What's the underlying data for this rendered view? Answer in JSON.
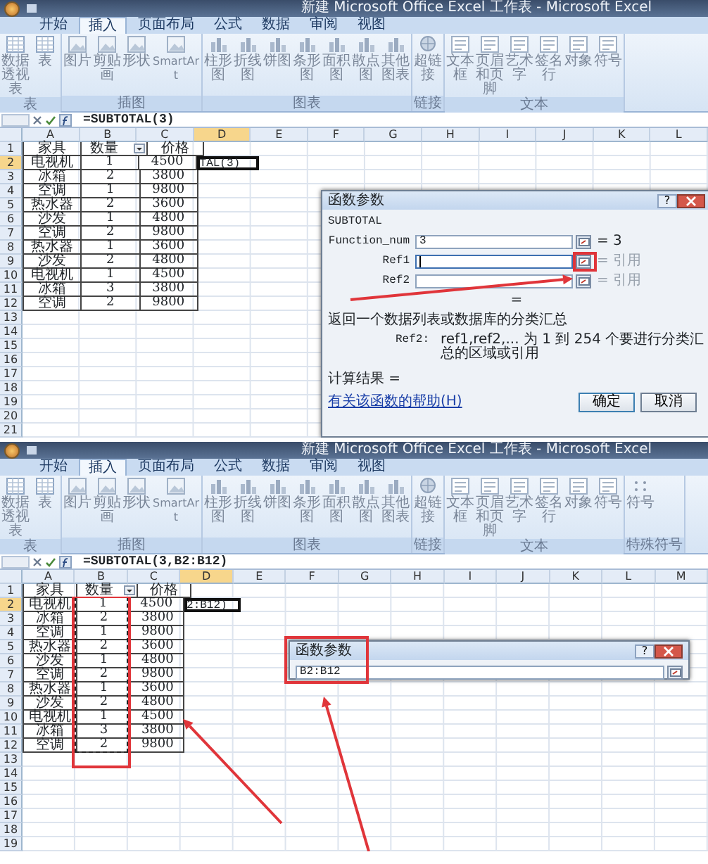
{
  "panels": [
    {
      "window_title": "新建 Microsoft Office Excel 工作表 - Microsoft Excel",
      "tabs": [
        {
          "label": "开始",
          "selected": false
        },
        {
          "label": "插入",
          "selected": true
        },
        {
          "label": "页面布局",
          "selected": false
        },
        {
          "label": "公式",
          "selected": false
        },
        {
          "label": "数据",
          "selected": false
        },
        {
          "label": "审阅",
          "selected": false
        },
        {
          "label": "视图",
          "selected": false
        }
      ],
      "ribbon_groups": [
        {
          "label": "表",
          "buttons": [
            "数据透视表",
            "表"
          ]
        },
        {
          "label": "插图",
          "buttons": [
            "图片",
            "剪贴画",
            "形状",
            "SmartArt"
          ]
        },
        {
          "label": "图表",
          "buttons": [
            "柱形图",
            "折线图",
            "饼图",
            "条形图",
            "面积图",
            "散点图",
            "其他图表"
          ]
        },
        {
          "label": "链接",
          "buttons": [
            "超链接"
          ]
        },
        {
          "label": "文本",
          "buttons": [
            "文本框",
            "页眉和页脚",
            "艺术字",
            "签名行",
            "对象",
            "符号"
          ]
        }
      ],
      "formula": "=SUBTOTAL(3)",
      "columns": [
        {
          "label": "A",
          "selected": false
        },
        {
          "label": "B",
          "selected": false
        },
        {
          "label": "C",
          "selected": false
        },
        {
          "label": "D",
          "selected": true
        },
        {
          "label": "E",
          "selected": false
        },
        {
          "label": "F",
          "selected": false
        },
        {
          "label": "G",
          "selected": false
        },
        {
          "label": "H",
          "selected": false
        },
        {
          "label": "I",
          "selected": false
        },
        {
          "label": "J",
          "selected": false
        },
        {
          "label": "K",
          "selected": false
        },
        {
          "label": "L",
          "selected": false
        }
      ],
      "rows": [
        {
          "number": "1",
          "selected": false,
          "cells": [
            "家具",
            "数量",
            "价格"
          ]
        },
        {
          "number": "2",
          "selected": true,
          "cells": [
            "电视机",
            "1",
            "4500",
            "TAL(3)"
          ]
        },
        {
          "number": "3",
          "selected": false,
          "cells": [
            "冰箱",
            "2",
            "3800"
          ]
        },
        {
          "number": "4",
          "selected": false,
          "cells": [
            "空调",
            "1",
            "9800"
          ]
        },
        {
          "number": "5",
          "selected": false,
          "cells": [
            "热水器",
            "2",
            "3600"
          ]
        },
        {
          "number": "6",
          "selected": false,
          "cells": [
            "沙发",
            "1",
            "4800"
          ]
        },
        {
          "number": "7",
          "selected": false,
          "cells": [
            "空调",
            "2",
            "9800"
          ]
        },
        {
          "number": "8",
          "selected": false,
          "cells": [
            "热水器",
            "1",
            "3600"
          ]
        },
        {
          "number": "9",
          "selected": false,
          "cells": [
            "沙发",
            "2",
            "4800"
          ]
        },
        {
          "number": "10",
          "selected": false,
          "cells": [
            "电视机",
            "1",
            "4500"
          ]
        },
        {
          "number": "11",
          "selected": false,
          "cells": [
            "冰箱",
            "3",
            "3800"
          ]
        },
        {
          "number": "12",
          "selected": false,
          "cells": [
            "空调",
            "2",
            "9800"
          ]
        },
        {
          "number": "13",
          "selected": false
        },
        {
          "number": "14",
          "selected": false
        },
        {
          "number": "15",
          "selected": false
        },
        {
          "number": "16",
          "selected": false
        },
        {
          "number": "17",
          "selected": false
        },
        {
          "number": "18",
          "selected": false
        },
        {
          "number": "19",
          "selected": false
        },
        {
          "number": "20",
          "selected": false
        },
        {
          "number": "21",
          "selected": false
        }
      ],
      "filter_button": true,
      "dialog": {
        "kind": "full",
        "title": "函数参数",
        "help": "?",
        "function_name": "SUBTOTAL",
        "args": [
          {
            "name": "Function_num",
            "value": "3",
            "focused": false,
            "result": "= 3"
          },
          {
            "name": "Ref1",
            "focused": true,
            "result": "= 引用"
          },
          {
            "name": "Ref2",
            "focused": false,
            "result": "= 引用"
          }
        ],
        "equals": "=",
        "description": "返回一个数据列表或数据库的分类汇总",
        "arg_help_name": "Ref2:",
        "arg_help": "ref1,ref2,... 为 1 到 254 个要进行分类汇总的区域或引用",
        "result_label": "计算结果 =",
        "help_link": "有关该函数的帮助(H)",
        "buttons": [
          "确定",
          "取消"
        ]
      }
    },
    {
      "window_title": "新建 Microsoft Office Excel 工作表 - Microsoft Excel",
      "tabs": [
        {
          "label": "开始",
          "selected": false
        },
        {
          "label": "插入",
          "selected": true
        },
        {
          "label": "页面布局",
          "selected": false
        },
        {
          "label": "公式",
          "selected": false
        },
        {
          "label": "数据",
          "selected": false
        },
        {
          "label": "审阅",
          "selected": false
        },
        {
          "label": "视图",
          "selected": false
        }
      ],
      "ribbon_groups": [
        {
          "label": "表",
          "buttons": [
            "数据透视表",
            "表"
          ]
        },
        {
          "label": "插图",
          "buttons": [
            "图片",
            "剪贴画",
            "形状",
            "SmartArt"
          ]
        },
        {
          "label": "图表",
          "buttons": [
            "柱形图",
            "折线图",
            "饼图",
            "条形图",
            "面积图",
            "散点图",
            "其他图表"
          ]
        },
        {
          "label": "链接",
          "buttons": [
            "超链接"
          ]
        },
        {
          "label": "文本",
          "buttons": [
            "文本框",
            "页眉和页脚",
            "艺术字",
            "签名行",
            "对象",
            "符号"
          ]
        },
        {
          "label": "特殊符号",
          "buttons": [
            "符号"
          ]
        }
      ],
      "formula": "=SUBTOTAL(3,B2:B12)",
      "columns": [
        {
          "label": "A",
          "selected": false
        },
        {
          "label": "B",
          "selected": false
        },
        {
          "label": "C",
          "selected": false
        },
        {
          "label": "D",
          "selected": true
        },
        {
          "label": "E",
          "selected": false
        },
        {
          "label": "F",
          "selected": false
        },
        {
          "label": "G",
          "selected": false
        },
        {
          "label": "H",
          "selected": false
        },
        {
          "label": "I",
          "selected": false
        },
        {
          "label": "J",
          "selected": false
        },
        {
          "label": "K",
          "selected": false
        },
        {
          "label": "L",
          "selected": false
        },
        {
          "label": "M",
          "selected": false
        }
      ],
      "rows": [
        {
          "number": "1",
          "selected": false,
          "cells": [
            "家具",
            "数量",
            "价格"
          ]
        },
        {
          "number": "2",
          "selected": true,
          "cells": [
            "电视机",
            "1",
            "4500",
            "2:B12)"
          ]
        },
        {
          "number": "3",
          "selected": false,
          "cells": [
            "冰箱",
            "2",
            "3800"
          ]
        },
        {
          "number": "4",
          "selected": false,
          "cells": [
            "空调",
            "1",
            "9800"
          ]
        },
        {
          "number": "5",
          "selected": false,
          "cells": [
            "热水器",
            "2",
            "3600"
          ]
        },
        {
          "number": "6",
          "selected": false,
          "cells": [
            "沙发",
            "1",
            "4800"
          ]
        },
        {
          "number": "7",
          "selected": false,
          "cells": [
            "空调",
            "2",
            "9800"
          ]
        },
        {
          "number": "8",
          "selected": false,
          "cells": [
            "热水器",
            "1",
            "3600"
          ]
        },
        {
          "number": "9",
          "selected": false,
          "cells": [
            "沙发",
            "2",
            "4800"
          ]
        },
        {
          "number": "10",
          "selected": false,
          "cells": [
            "电视机",
            "1",
            "4500"
          ]
        },
        {
          "number": "11",
          "selected": false,
          "cells": [
            "冰箱",
            "3",
            "3800"
          ]
        },
        {
          "number": "12",
          "selected": false,
          "cells": [
            "空调",
            "2",
            "9800"
          ]
        },
        {
          "number": "13",
          "selected": false
        },
        {
          "number": "14",
          "selected": false
        },
        {
          "number": "15",
          "selected": false
        },
        {
          "number": "16",
          "selected": false
        },
        {
          "number": "17",
          "selected": false
        },
        {
          "number": "18",
          "selected": false
        },
        {
          "number": "19",
          "selected": false
        }
      ],
      "filter_button": true,
      "range_marquee": true,
      "dialog": {
        "kind": "collapsed",
        "title": "函数参数",
        "help": "?",
        "value": "B2:B12"
      }
    }
  ]
}
